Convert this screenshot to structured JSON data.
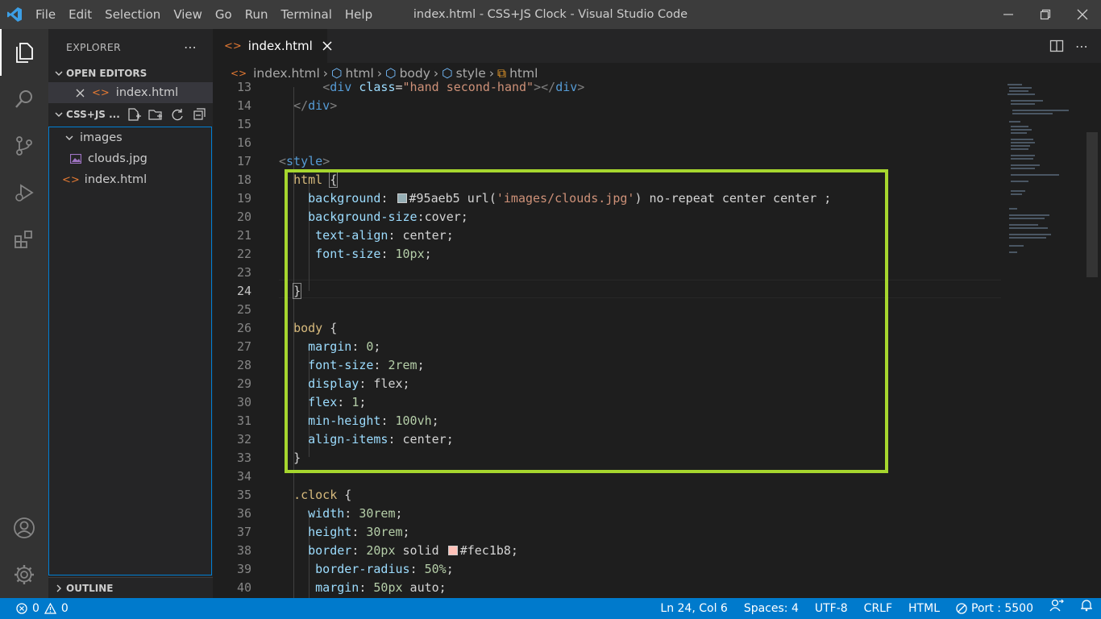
{
  "window": {
    "title": "index.html - CSS+JS Clock - Visual Studio Code"
  },
  "menu": [
    "File",
    "Edit",
    "Selection",
    "View",
    "Go",
    "Run",
    "Terminal",
    "Help"
  ],
  "sidebar": {
    "title": "EXPLORER",
    "open_editors_label": "OPEN EDITORS",
    "open_editor_file": "index.html",
    "folder_label": "CSS+JS ...",
    "tree": [
      {
        "label": "images",
        "kind": "folder"
      },
      {
        "label": "clouds.jpg",
        "kind": "image"
      },
      {
        "label": "index.html",
        "kind": "html"
      }
    ],
    "outline_label": "OUTLINE"
  },
  "tab": {
    "label": "index.html"
  },
  "breadcrumb": [
    "index.html",
    "html",
    "body",
    "style",
    "html"
  ],
  "editor": {
    "current_line": 24,
    "colors": {
      "swatch_1": "#95aeb5",
      "swatch_2": "#fec1b8",
      "highlight_box": "#a6d62e"
    }
  },
  "statusbar": {
    "errors": "0",
    "warnings": "0",
    "position": "Ln 24, Col 6",
    "spaces": "Spaces: 4",
    "encoding": "UTF-8",
    "eol": "CRLF",
    "language": "HTML",
    "port": "Port : 5500"
  }
}
